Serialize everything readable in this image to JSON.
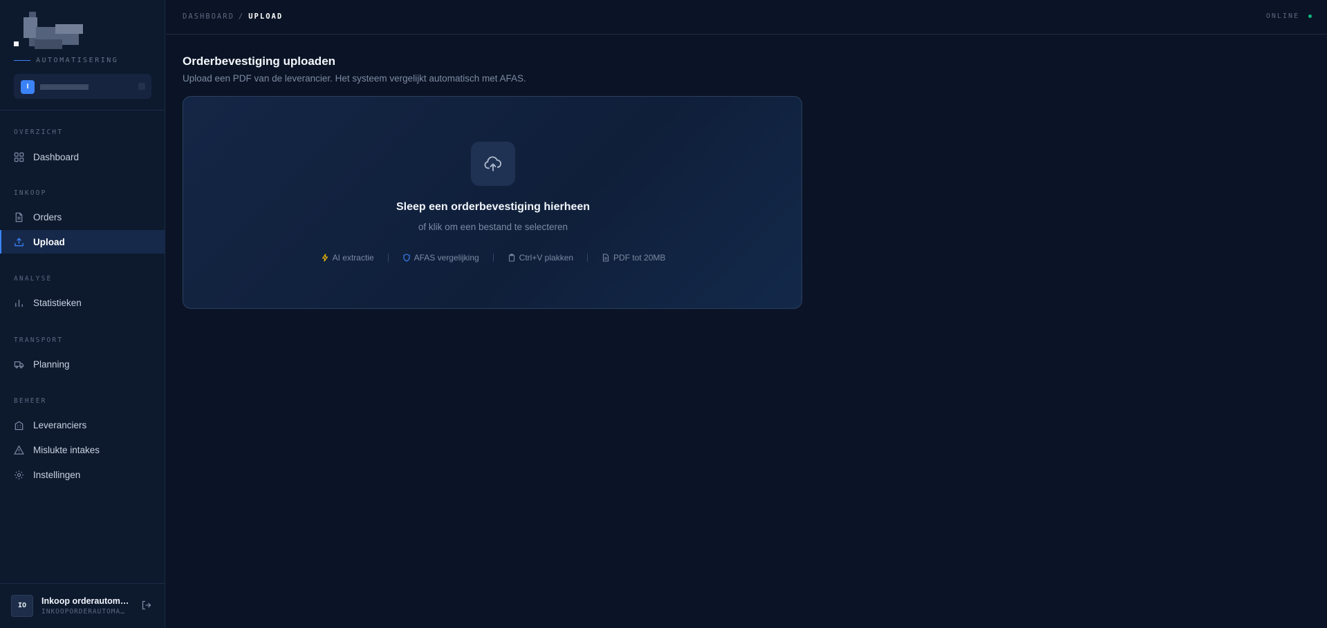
{
  "sidebar": {
    "brand_sub": "AUTOMATISERING",
    "workspace_badge": "I",
    "sections": [
      {
        "label": "OVERZICHT",
        "items": [
          {
            "label": "Dashboard",
            "icon": "grid-icon"
          }
        ]
      },
      {
        "label": "INKOOP",
        "items": [
          {
            "label": "Orders",
            "icon": "file-icon"
          },
          {
            "label": "Upload",
            "icon": "upload-icon",
            "active": true
          }
        ]
      },
      {
        "label": "ANALYSE",
        "items": [
          {
            "label": "Statistieken",
            "icon": "bar-chart-icon"
          }
        ]
      },
      {
        "label": "TRANSPORT",
        "items": [
          {
            "label": "Planning",
            "icon": "truck-icon"
          }
        ]
      },
      {
        "label": "BEHEER",
        "items": [
          {
            "label": "Leveranciers",
            "icon": "building-icon"
          },
          {
            "label": "Mislukte intakes",
            "icon": "warning-icon"
          },
          {
            "label": "Instellingen",
            "icon": "gear-icon"
          }
        ]
      }
    ],
    "user": {
      "initials": "IO",
      "name": "Inkoop orderautoma…",
      "sub": "INKOOPORDERAUTOMA…"
    }
  },
  "topbar": {
    "crumb_root": "DASHBOARD",
    "crumb_sep": "/",
    "crumb_current": "UPLOAD",
    "status": "ONLINE",
    "status_color": "#10b981"
  },
  "main": {
    "title": "Orderbevestiging uploaden",
    "subtitle": "Upload een PDF van de leverancier. Het systeem vergelijkt automatisch met AFAS.",
    "dropzone": {
      "icon": "cloud-upload-icon",
      "title": "Sleep een orderbevestiging hierheen",
      "subtitle": "of klik om een bestand te selecteren",
      "features": [
        {
          "label": "AI extractie",
          "icon": "bolt-icon",
          "color": "#eab308"
        },
        {
          "label": "AFAS vergelijking",
          "icon": "shield-icon",
          "color": "#3b82f6"
        },
        {
          "label": "Ctrl+V plakken",
          "icon": "clipboard-icon",
          "color": "#7c8aa3"
        },
        {
          "label": "PDF tot 20MB",
          "icon": "document-icon",
          "color": "#7c8aa3"
        }
      ]
    }
  },
  "colors": {
    "accent": "#3b82f6",
    "background": "#0b1426",
    "sidebar": "#0d1a2e"
  }
}
